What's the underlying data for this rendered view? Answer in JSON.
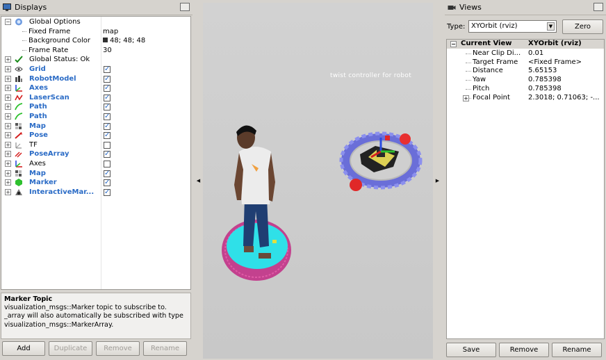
{
  "displays": {
    "title": "Displays",
    "rows": [
      {
        "label": "Global Options",
        "value": "",
        "indent": 0,
        "blue": false,
        "icon": "globe-icon",
        "exp": "−",
        "check": null
      },
      {
        "label": "Fixed Frame",
        "value": "map",
        "indent": 1,
        "blue": false,
        "icon": "",
        "exp": "",
        "check": null
      },
      {
        "label": "Background Color",
        "value": "48; 48; 48",
        "indent": 1,
        "blue": false,
        "icon": "",
        "exp": "",
        "check": null,
        "swatch": "#303030"
      },
      {
        "label": "Frame Rate",
        "value": "30",
        "indent": 1,
        "blue": false,
        "icon": "",
        "exp": "",
        "check": null
      },
      {
        "label": "Global Status: Ok",
        "value": "",
        "indent": 0,
        "blue": false,
        "icon": "checkmark-icon",
        "exp": "+",
        "check": null
      },
      {
        "label": "Grid",
        "value": "",
        "indent": 0,
        "blue": true,
        "icon": "grid-icon",
        "exp": "+",
        "check": true
      },
      {
        "label": "RobotModel",
        "value": "",
        "indent": 0,
        "blue": true,
        "icon": "robot-model-icon",
        "exp": "+",
        "check": true
      },
      {
        "label": "Axes",
        "value": "",
        "indent": 0,
        "blue": true,
        "icon": "axes-icon",
        "exp": "+",
        "check": true
      },
      {
        "label": "LaserScan",
        "value": "",
        "indent": 0,
        "blue": true,
        "icon": "laserscan-icon",
        "exp": "+",
        "check": true
      },
      {
        "label": "Path",
        "value": "",
        "indent": 0,
        "blue": true,
        "icon": "path-icon",
        "exp": "+",
        "check": true
      },
      {
        "label": "Path",
        "value": "",
        "indent": 0,
        "blue": true,
        "icon": "path-icon",
        "exp": "+",
        "check": true
      },
      {
        "label": "Map",
        "value": "",
        "indent": 0,
        "blue": true,
        "icon": "map-icon",
        "exp": "+",
        "check": true
      },
      {
        "label": "Pose",
        "value": "",
        "indent": 0,
        "blue": true,
        "icon": "pose-icon",
        "exp": "+",
        "check": true
      },
      {
        "label": "TF",
        "value": "",
        "indent": 0,
        "blue": false,
        "icon": "tf-icon",
        "exp": "+",
        "check": false
      },
      {
        "label": "PoseArray",
        "value": "",
        "indent": 0,
        "blue": true,
        "icon": "posearray-icon",
        "exp": "+",
        "check": true
      },
      {
        "label": "Axes",
        "value": "",
        "indent": 0,
        "blue": false,
        "icon": "axes-icon",
        "exp": "+",
        "check": false
      },
      {
        "label": "Map",
        "value": "",
        "indent": 0,
        "blue": true,
        "icon": "map-icon",
        "exp": "+",
        "check": true
      },
      {
        "label": "Marker",
        "value": "",
        "indent": 0,
        "blue": true,
        "icon": "marker-icon",
        "exp": "+",
        "check": true
      },
      {
        "label": "InteractiveMar...",
        "value": "",
        "indent": 0,
        "blue": true,
        "icon": "interactive-marker-icon",
        "exp": "+",
        "check": true
      }
    ],
    "description": {
      "title": "Marker Topic",
      "text": "visualization_msgs::Marker topic to subscribe to. _array will also automatically be subscribed with type visualization_msgs::MarkerArray."
    },
    "buttons": {
      "add": "Add",
      "duplicate": "Duplicate",
      "remove": "Remove",
      "rename": "Rename"
    }
  },
  "viewport": {
    "overlay_text": "twist controller for robot"
  },
  "views": {
    "title": "Views",
    "type_label": "Type:",
    "type_value": "XYOrbit (rviz)",
    "zero_button": "Zero",
    "current_view": {
      "label": "Current View",
      "value": "XYOrbit (rviz)"
    },
    "props": [
      {
        "label": "Near Clip Di...",
        "value": "0.01"
      },
      {
        "label": "Target Frame",
        "value": "<Fixed Frame>"
      },
      {
        "label": "Distance",
        "value": "5.65153"
      },
      {
        "label": "Yaw",
        "value": "0.785398"
      },
      {
        "label": "Pitch",
        "value": "0.785398"
      },
      {
        "label": "Focal Point",
        "value": "2.3018; 0.71063; -..."
      }
    ],
    "buttons": {
      "save": "Save",
      "remove": "Remove",
      "rename": "Rename"
    }
  }
}
